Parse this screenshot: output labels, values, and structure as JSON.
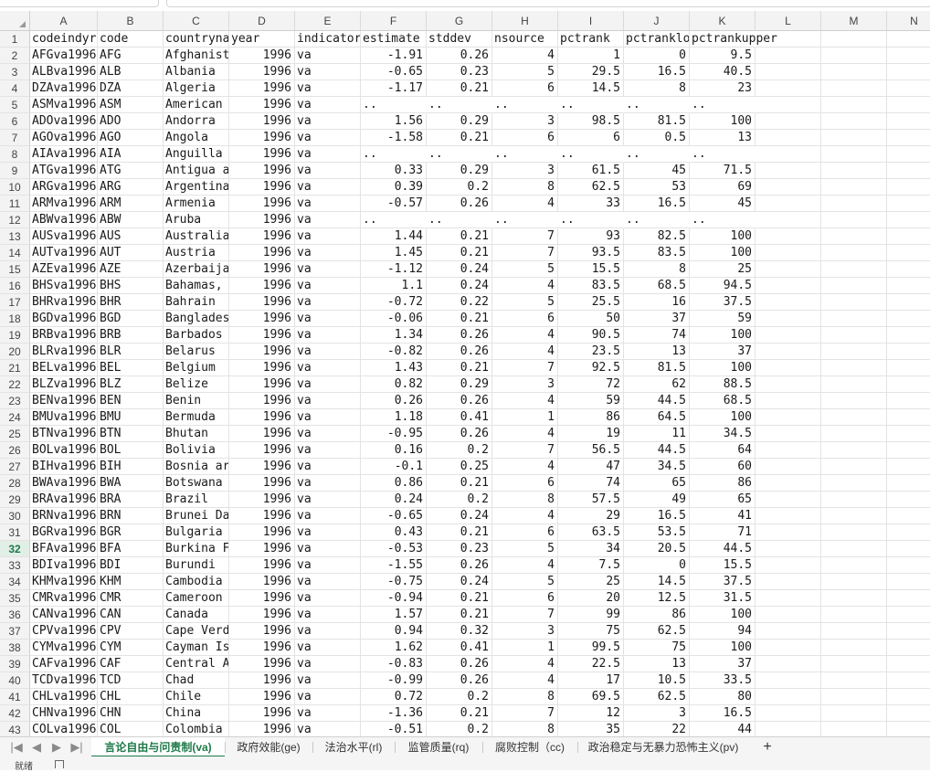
{
  "columns": [
    {
      "letter": "A",
      "w": 74
    },
    {
      "letter": "B",
      "w": 72
    },
    {
      "letter": "C",
      "w": 72
    },
    {
      "letter": "D",
      "w": 72
    },
    {
      "letter": "E",
      "w": 72
    },
    {
      "letter": "F",
      "w": 72
    },
    {
      "letter": "G",
      "w": 72
    },
    {
      "letter": "H",
      "w": 72
    },
    {
      "letter": "I",
      "w": 72
    },
    {
      "letter": "J",
      "w": 72
    },
    {
      "letter": "K",
      "w": 72
    },
    {
      "letter": "L",
      "w": 72
    },
    {
      "letter": "M",
      "w": 72
    },
    {
      "letter": "N",
      "w": 60
    }
  ],
  "active_row": 32,
  "header_row": [
    "codeindyr",
    "code",
    "countryna",
    "year",
    "indicator",
    "estimate",
    "stddev",
    "nsource",
    "pctrank",
    "pctranklo",
    "pctrankupper"
  ],
  "rows": [
    [
      "AFGva1996",
      "AFG",
      "Afghanist",
      "1996",
      "va",
      "-1.91",
      "0.26",
      "4",
      "1",
      "0",
      "9.5"
    ],
    [
      "ALBva1996",
      "ALB",
      "Albania",
      "1996",
      "va",
      "-0.65",
      "0.23",
      "5",
      "29.5",
      "16.5",
      "40.5"
    ],
    [
      "DZAva1996",
      "DZA",
      "Algeria",
      "1996",
      "va",
      "-1.17",
      "0.21",
      "6",
      "14.5",
      "8",
      "23"
    ],
    [
      "ASMva1996",
      "ASM",
      "American",
      "1996",
      "va",
      "..",
      "..",
      "..",
      "..",
      "..",
      ".."
    ],
    [
      "ADOva1996",
      "ADO",
      "Andorra",
      "1996",
      "va",
      "1.56",
      "0.29",
      "3",
      "98.5",
      "81.5",
      "100"
    ],
    [
      "AGOva1996",
      "AGO",
      "Angola",
      "1996",
      "va",
      "-1.58",
      "0.21",
      "6",
      "6",
      "0.5",
      "13"
    ],
    [
      "AIAva1996",
      "AIA",
      "Anguilla",
      "1996",
      "va",
      "..",
      "..",
      "..",
      "..",
      "..",
      ".."
    ],
    [
      "ATGva1996",
      "ATG",
      "Antigua a",
      "1996",
      "va",
      "0.33",
      "0.29",
      "3",
      "61.5",
      "45",
      "71.5"
    ],
    [
      "ARGva1996",
      "ARG",
      "Argentina",
      "1996",
      "va",
      "0.39",
      "0.2",
      "8",
      "62.5",
      "53",
      "69"
    ],
    [
      "ARMva1996",
      "ARM",
      "Armenia",
      "1996",
      "va",
      "-0.57",
      "0.26",
      "4",
      "33",
      "16.5",
      "45"
    ],
    [
      "ABWva1996",
      "ABW",
      "Aruba",
      "1996",
      "va",
      "..",
      "..",
      "..",
      "..",
      "..",
      ".."
    ],
    [
      "AUSva1996",
      "AUS",
      "Australia",
      "1996",
      "va",
      "1.44",
      "0.21",
      "7",
      "93",
      "82.5",
      "100"
    ],
    [
      "AUTva1996",
      "AUT",
      "Austria",
      "1996",
      "va",
      "1.45",
      "0.21",
      "7",
      "93.5",
      "83.5",
      "100"
    ],
    [
      "AZEva1996",
      "AZE",
      "Azerbaija",
      "1996",
      "va",
      "-1.12",
      "0.24",
      "5",
      "15.5",
      "8",
      "25"
    ],
    [
      "BHSva1996",
      "BHS",
      "Bahamas,",
      "1996",
      "va",
      "1.1",
      "0.24",
      "4",
      "83.5",
      "68.5",
      "94.5"
    ],
    [
      "BHRva1996",
      "BHR",
      "Bahrain",
      "1996",
      "va",
      "-0.72",
      "0.22",
      "5",
      "25.5",
      "16",
      "37.5"
    ],
    [
      "BGDva1996",
      "BGD",
      "Banglades",
      "1996",
      "va",
      "-0.06",
      "0.21",
      "6",
      "50",
      "37",
      "59"
    ],
    [
      "BRBva1996",
      "BRB",
      "Barbados",
      "1996",
      "va",
      "1.34",
      "0.26",
      "4",
      "90.5",
      "74",
      "100"
    ],
    [
      "BLRva1996",
      "BLR",
      "Belarus",
      "1996",
      "va",
      "-0.82",
      "0.26",
      "4",
      "23.5",
      "13",
      "37"
    ],
    [
      "BELva1996",
      "BEL",
      "Belgium",
      "1996",
      "va",
      "1.43",
      "0.21",
      "7",
      "92.5",
      "81.5",
      "100"
    ],
    [
      "BLZva1996",
      "BLZ",
      "Belize",
      "1996",
      "va",
      "0.82",
      "0.29",
      "3",
      "72",
      "62",
      "88.5"
    ],
    [
      "BENva1996",
      "BEN",
      "Benin",
      "1996",
      "va",
      "0.26",
      "0.26",
      "4",
      "59",
      "44.5",
      "68.5"
    ],
    [
      "BMUva1996",
      "BMU",
      "Bermuda",
      "1996",
      "va",
      "1.18",
      "0.41",
      "1",
      "86",
      "64.5",
      "100"
    ],
    [
      "BTNva1996",
      "BTN",
      "Bhutan",
      "1996",
      "va",
      "-0.95",
      "0.26",
      "4",
      "19",
      "11",
      "34.5"
    ],
    [
      "BOLva1996",
      "BOL",
      "Bolivia",
      "1996",
      "va",
      "0.16",
      "0.2",
      "7",
      "56.5",
      "44.5",
      "64"
    ],
    [
      "BIHva1996",
      "BIH",
      "Bosnia ar",
      "1996",
      "va",
      "-0.1",
      "0.25",
      "4",
      "47",
      "34.5",
      "60"
    ],
    [
      "BWAva1996",
      "BWA",
      "Botswana",
      "1996",
      "va",
      "0.86",
      "0.21",
      "6",
      "74",
      "65",
      "86"
    ],
    [
      "BRAva1996",
      "BRA",
      "Brazil",
      "1996",
      "va",
      "0.24",
      "0.2",
      "8",
      "57.5",
      "49",
      "65"
    ],
    [
      "BRNva1996",
      "BRN",
      "Brunei Da",
      "1996",
      "va",
      "-0.65",
      "0.24",
      "4",
      "29",
      "16.5",
      "41"
    ],
    [
      "BGRva1996",
      "BGR",
      "Bulgaria",
      "1996",
      "va",
      "0.43",
      "0.21",
      "6",
      "63.5",
      "53.5",
      "71"
    ],
    [
      "BFAva1996",
      "BFA",
      "Burkina F",
      "1996",
      "va",
      "-0.53",
      "0.23",
      "5",
      "34",
      "20.5",
      "44.5"
    ],
    [
      "BDIva1996",
      "BDI",
      "Burundi",
      "1996",
      "va",
      "-1.55",
      "0.26",
      "4",
      "7.5",
      "0",
      "15.5"
    ],
    [
      "KHMva1996",
      "KHM",
      "Cambodia",
      "1996",
      "va",
      "-0.75",
      "0.24",
      "5",
      "25",
      "14.5",
      "37.5"
    ],
    [
      "CMRva1996",
      "CMR",
      "Cameroon",
      "1996",
      "va",
      "-0.94",
      "0.21",
      "6",
      "20",
      "12.5",
      "31.5"
    ],
    [
      "CANva1996",
      "CAN",
      "Canada",
      "1996",
      "va",
      "1.57",
      "0.21",
      "7",
      "99",
      "86",
      "100"
    ],
    [
      "CPVva1996",
      "CPV",
      "Cape Verd",
      "1996",
      "va",
      "0.94",
      "0.32",
      "3",
      "75",
      "62.5",
      "94"
    ],
    [
      "CYMva1996",
      "CYM",
      "Cayman Is",
      "1996",
      "va",
      "1.62",
      "0.41",
      "1",
      "99.5",
      "75",
      "100"
    ],
    [
      "CAFva1996",
      "CAF",
      "Central A",
      "1996",
      "va",
      "-0.83",
      "0.26",
      "4",
      "22.5",
      "13",
      "37"
    ],
    [
      "TCDva1996",
      "TCD",
      "Chad",
      "1996",
      "va",
      "-0.99",
      "0.26",
      "4",
      "17",
      "10.5",
      "33.5"
    ],
    [
      "CHLva1996",
      "CHL",
      "Chile",
      "1996",
      "va",
      "0.72",
      "0.2",
      "8",
      "69.5",
      "62.5",
      "80"
    ],
    [
      "CHNva1996",
      "CHN",
      "China",
      "1996",
      "va",
      "-1.36",
      "0.21",
      "7",
      "12",
      "3",
      "16.5"
    ],
    [
      "COLva1996",
      "COL",
      "Colombia",
      "1996",
      "va",
      "-0.51",
      "0.2",
      "8",
      "35",
      "22",
      "44"
    ]
  ],
  "tabs": [
    {
      "label": "言论自由与问责制(va)",
      "active": true
    },
    {
      "label": "政府效能(ge)",
      "active": false
    },
    {
      "label": "法治水平(rl)",
      "active": false
    },
    {
      "label": "监管质量(rq)",
      "active": false
    },
    {
      "label": "腐败控制（cc)",
      "active": false
    },
    {
      "label": "政治稳定与无暴力恐怖主义(pv)",
      "active": false
    }
  ],
  "nav": {
    "first": "|◀",
    "prev": "◀",
    "next": "▶",
    "last": "▶|",
    "add": "+"
  },
  "status": {
    "text": "就绪"
  }
}
